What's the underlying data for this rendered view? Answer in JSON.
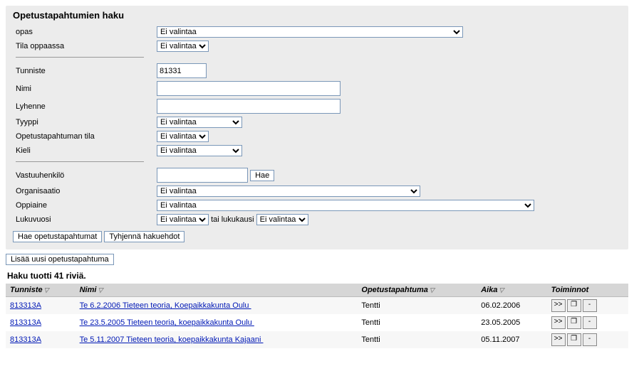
{
  "heading": "Opetustapahtumien haku",
  "form": {
    "opas_label": "opas",
    "opas_value": "Ei valintaa",
    "tila_oppaassa_label": "Tila oppaassa",
    "tila_oppaassa_value": "Ei valintaa",
    "tunniste_label": "Tunniste",
    "tunniste_value": "81331",
    "nimi_label": "Nimi",
    "nimi_value": "",
    "lyhenne_label": "Lyhenne",
    "lyhenne_value": "",
    "tyyppi_label": "Tyyppi",
    "tyyppi_value": "Ei valintaa",
    "opetustapahtuman_tila_label": "Opetustapahtuman tila",
    "opetustapahtuman_tila_value": "Ei valintaa",
    "kieli_label": "Kieli",
    "kieli_value": "Ei valintaa",
    "vastuuhenkilo_label": "Vastuuhenkilö",
    "vastuuhenkilo_value": "",
    "vastuuhenkilo_hae": "Hae",
    "organisaatio_label": "Organisaatio",
    "organisaatio_value": "Ei valintaa",
    "oppiaine_label": "Oppiaine",
    "oppiaine_value": "Ei valintaa",
    "lukuvuosi_label": "Lukuvuosi",
    "lukuvuosi_value": "Ei valintaa",
    "tai_lukukausi_label": "tai lukukausi",
    "lukukausi_value": "Ei valintaa",
    "hae_button": "Hae opetustapahtumat",
    "tyhjenna_button": "Tyhjennä hakuehdot",
    "lisaa_button": "Lisää uusi opetustapahtuma"
  },
  "results_heading": "Haku tuotti 41 riviä.",
  "columns": {
    "tunniste": "Tunniste",
    "nimi": "Nimi",
    "opetustapahtuma": "Opetustapahtuma",
    "aika": "Aika",
    "toiminnot": "Toiminnot"
  },
  "rows": [
    {
      "tunniste": "813313A",
      "nimi": "Te 6.2.2006 Tieteen teoria, Koepaikkakunta Oulu",
      "opetustapahtuma": "Tentti",
      "aika": "06.02.2006"
    },
    {
      "tunniste": "813313A",
      "nimi": "Te 23.5.2005 Tieteen teoria, koepaikkakunta Oulu",
      "opetustapahtuma": "Tentti",
      "aika": "23.05.2005"
    },
    {
      "tunniste": "813313A",
      "nimi": "Te 5.11.2007 Tieteen teoria, koepaikkakunta Kajaani",
      "opetustapahtuma": "Tentti",
      "aika": "05.11.2007"
    }
  ],
  "icons": {
    "forward": ">>",
    "copy": "❐",
    "minus": "-",
    "sort": "▽"
  }
}
